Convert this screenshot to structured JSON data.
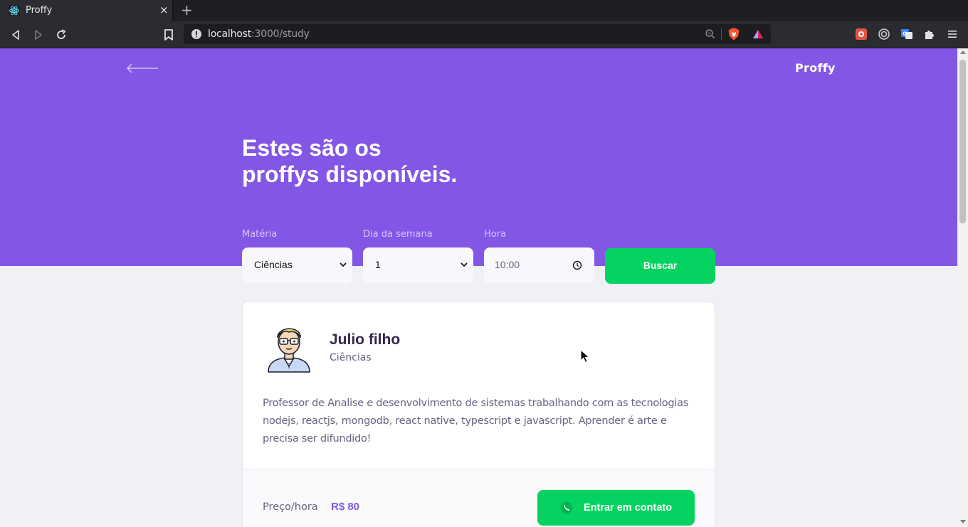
{
  "browser": {
    "tab_title": "Proffy",
    "tab_close": "×",
    "new_tab": "+",
    "url_host": "localhost",
    "url_path": ":3000/study"
  },
  "header": {
    "logo": "Proffy",
    "title_line1": "Estes são os",
    "title_line2": "proffys disponíveis."
  },
  "filters": {
    "subject_label": "Matéria",
    "subject_value": "Ciências",
    "weekday_label": "Dia da semana",
    "weekday_value": "1",
    "time_label": "Hora",
    "time_value": "10:00",
    "search_label": "Buscar"
  },
  "teacher": {
    "name": "Julio filho",
    "subject": "Ciências",
    "bio": "Professor de Analise e desenvolvimento de sistemas trabalhando com as tecnologias nodejs, reactjs, mongodb, react native, typescript e javascript. Aprender é arte e precisa ser difundido!",
    "price_label": "Preço/hora",
    "price_value": "R$ 80",
    "contact_label": "Entrar em contato"
  },
  "colors": {
    "primary": "#8257e5",
    "secondary": "#04d361",
    "background": "#f0f0f7"
  }
}
